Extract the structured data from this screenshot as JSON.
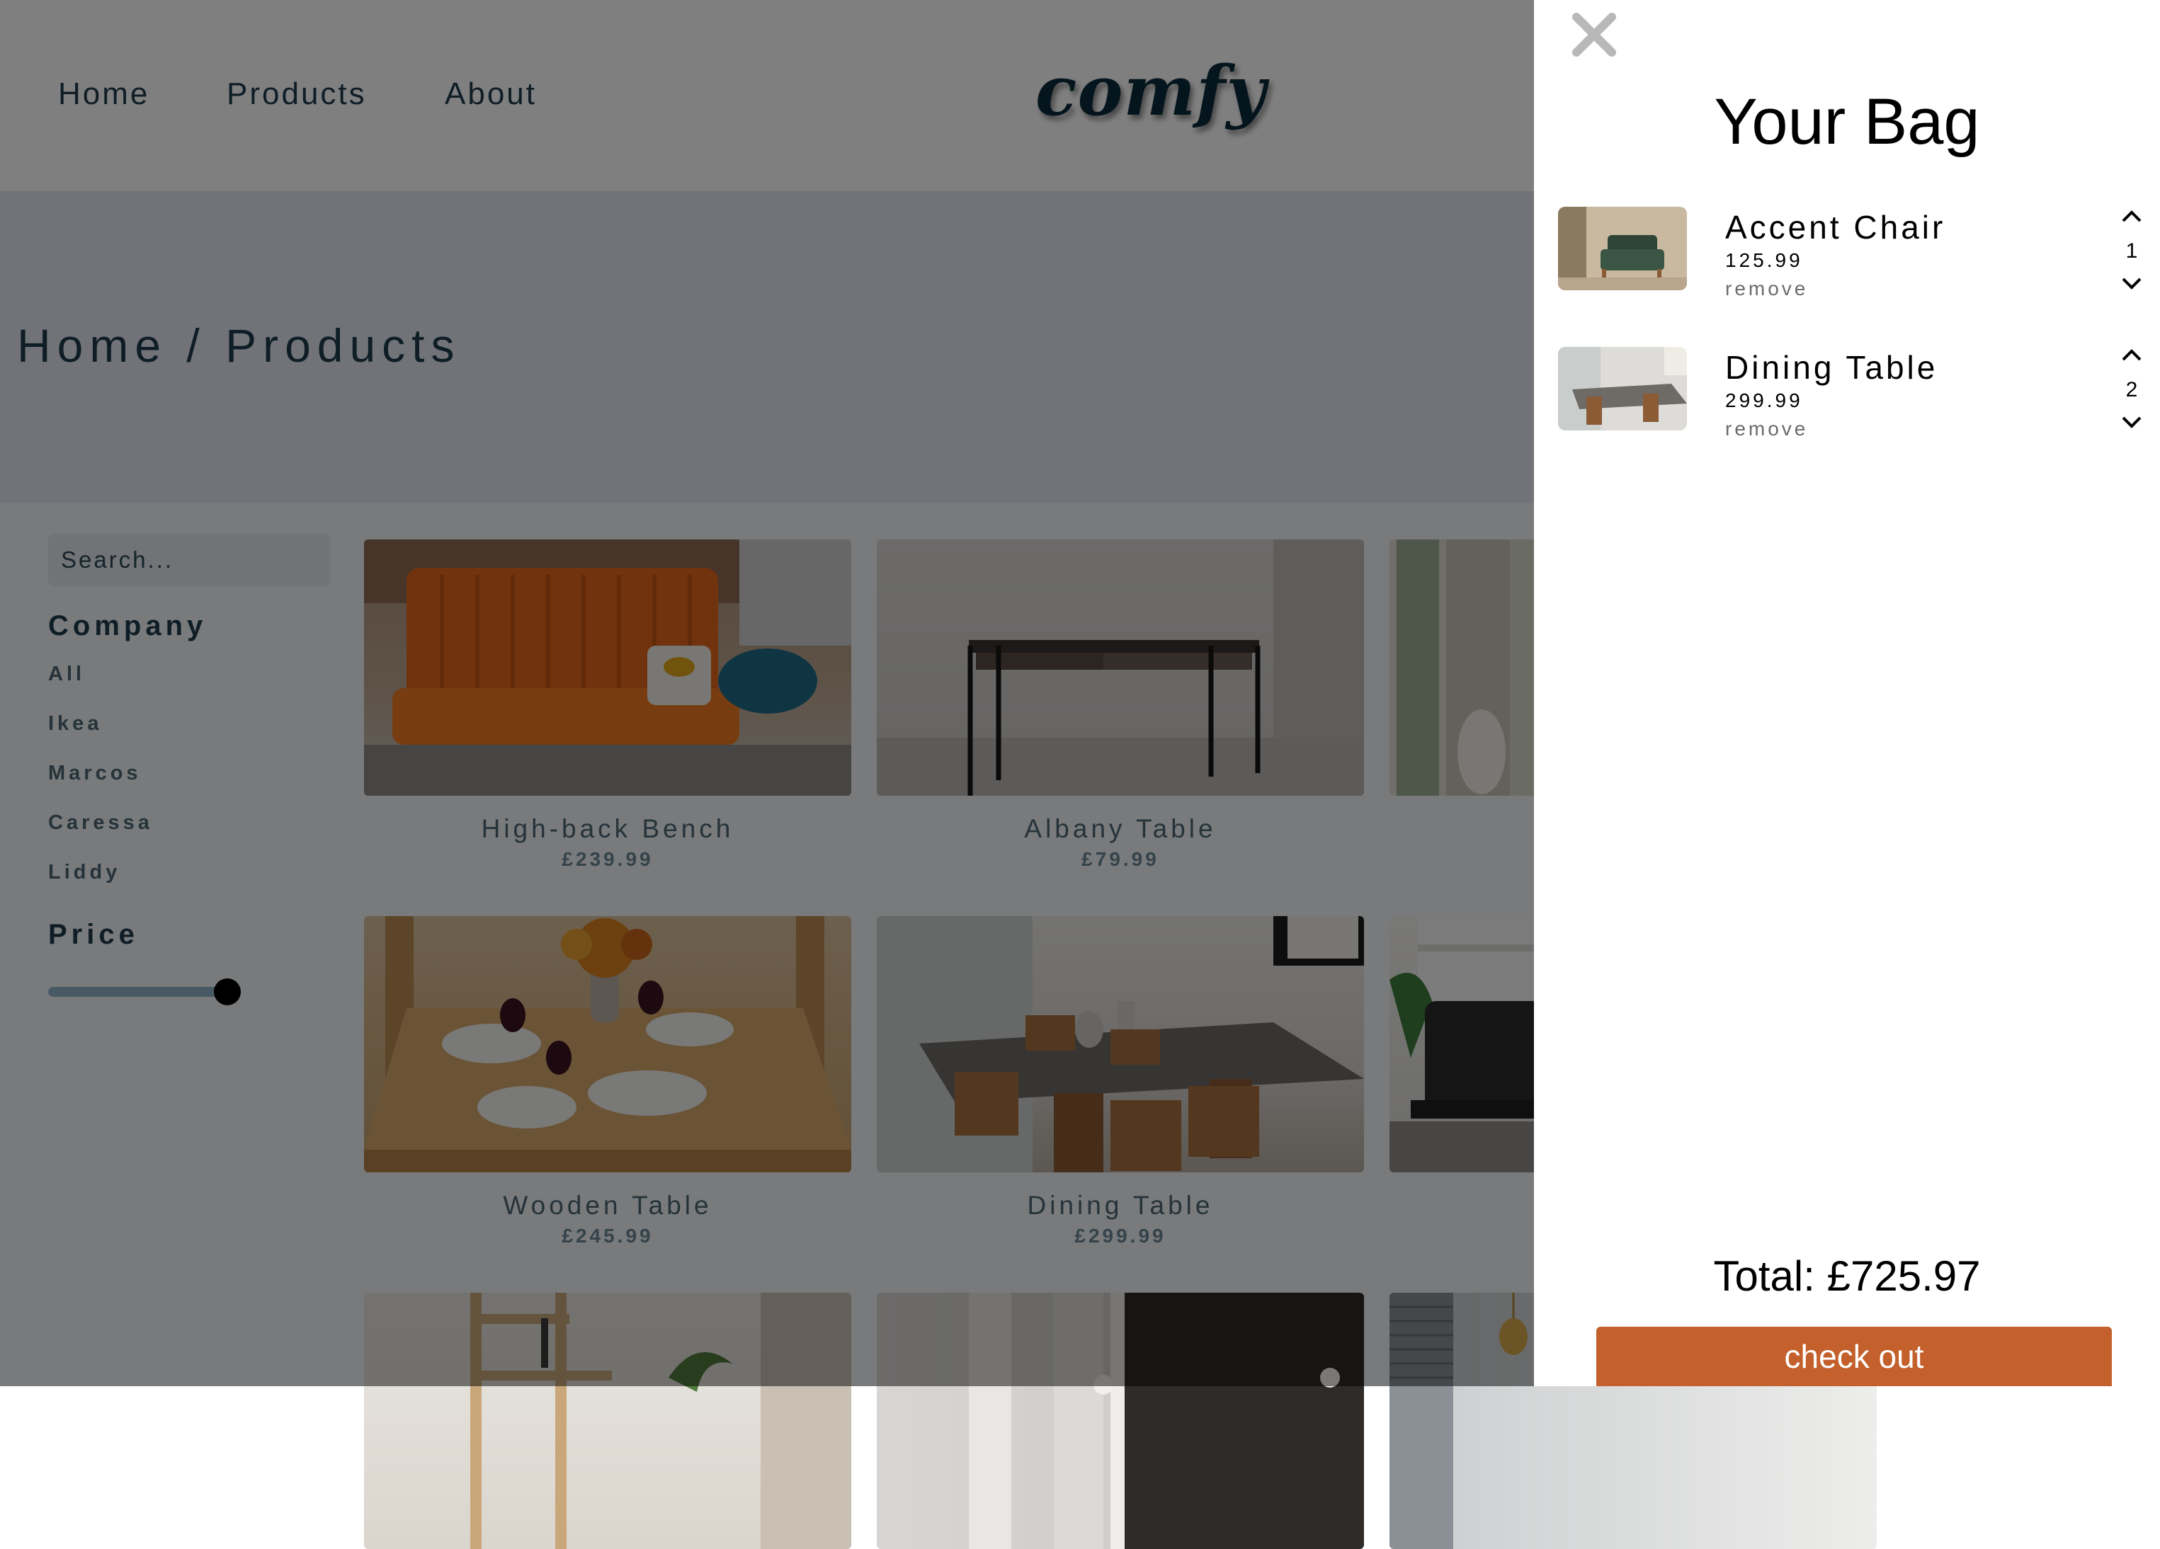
{
  "navbar": {
    "links": [
      "Home",
      "Products",
      "About"
    ],
    "logo": "comfy"
  },
  "hero": {
    "breadcrumb": "Home / Products"
  },
  "filters": {
    "search_placeholder": "Search...",
    "company_title": "Company",
    "companies": [
      "All",
      "Ikea",
      "Marcos",
      "Caressa",
      "Liddy"
    ],
    "price_title": "Price",
    "price_slider_value_fraction": 1.0
  },
  "products": [
    {
      "name": "High-back Bench",
      "price": "£239.99"
    },
    {
      "name": "Albany Table",
      "price": "£79.99"
    },
    {
      "name": "Wooden Table",
      "price": "£245.99"
    },
    {
      "name": "Dining Table",
      "price": "£299.99"
    }
  ],
  "cart": {
    "title": "Your Bag",
    "items": [
      {
        "name": "Accent Chair",
        "price": "125.99",
        "remove_label": "remove",
        "quantity": "1"
      },
      {
        "name": "Dining Table",
        "price": "299.99",
        "remove_label": "remove",
        "quantity": "2"
      }
    ],
    "total": "Total: £725.97",
    "checkout_label": "check out"
  },
  "colors": {
    "accent": "#c3602c",
    "text_dark": "#1f3b4d",
    "overlay": "rgba(0,0,0,0.5)"
  }
}
